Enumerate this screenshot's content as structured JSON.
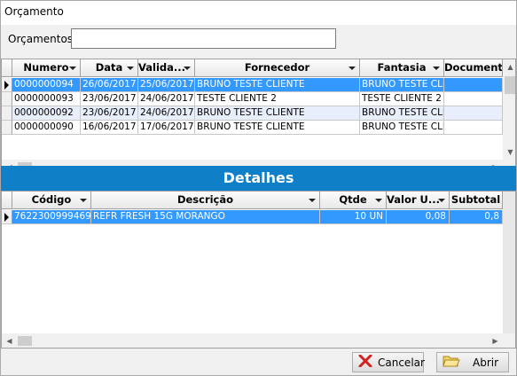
{
  "window": {
    "title": "Orçamento"
  },
  "search": {
    "label": "Orçamentos",
    "value": ""
  },
  "top_grid": {
    "columns": [
      "Numero",
      "Data",
      "Valida...",
      "Fornecedor",
      "Fantasia",
      "Documento"
    ],
    "rows": [
      [
        "0000000094",
        "26/06/2017",
        "25/06/2017",
        "BRUNO TESTE CLIENTE",
        "BRUNO TESTE CLIE",
        ""
      ],
      [
        "0000000093",
        "23/06/2017",
        "24/06/2017",
        "TESTE CLIENTE 2",
        "TESTE CLIENTE 2",
        ""
      ],
      [
        "0000000092",
        "23/06/2017",
        "24/06/2017",
        "BRUNO TESTE CLIENTE",
        "BRUNO TESTE CLIE",
        ""
      ],
      [
        "0000000090",
        "16/06/2017",
        "17/06/2017",
        "BRUNO TESTE CLIENTE",
        "BRUNO TESTE CLIE",
        ""
      ]
    ]
  },
  "details": {
    "title": "Detalhes",
    "columns": [
      "Código",
      "Descrição",
      "Qtde",
      "Valor U...",
      "Subtotal"
    ],
    "rows": [
      [
        "7622300999469",
        "REFR FRESH 15G MORANGO",
        "10 UN",
        "0,08",
        "0,8"
      ]
    ]
  },
  "buttons": {
    "cancel": "Cancelar",
    "open": "Abrir"
  },
  "colors": {
    "selection": "#3399ff",
    "banner": "#0f7fc8",
    "cancel_icon": "#d32020",
    "open_icon": "#e8c040"
  },
  "icons": {
    "cancel": "close-x-icon",
    "open": "open-folder-icon"
  }
}
